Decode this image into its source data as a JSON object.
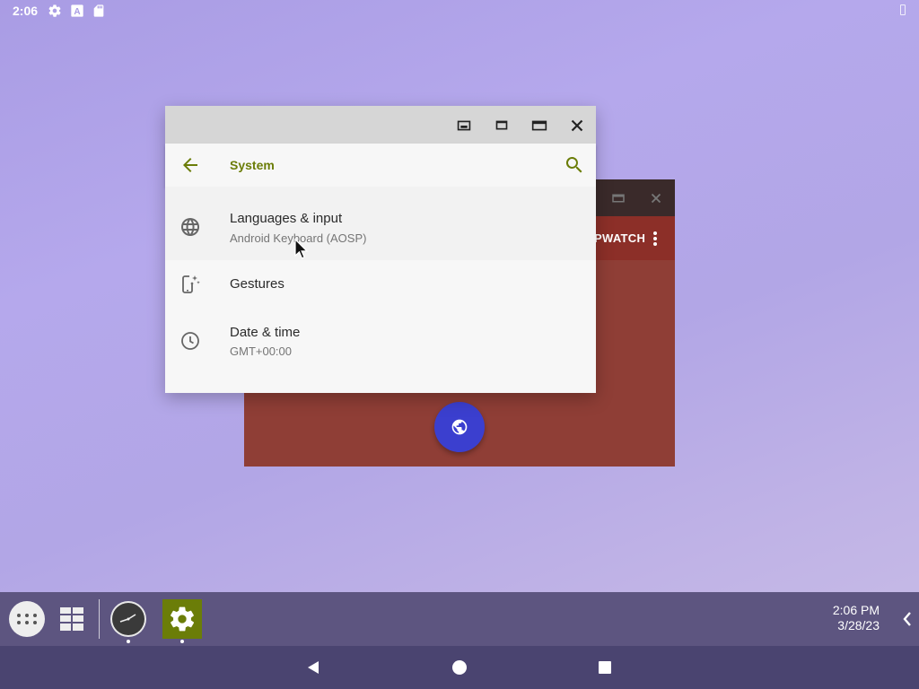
{
  "status_bar": {
    "time": "2:06",
    "icons": [
      "gear-icon",
      "keyboard-a-icon",
      "sd-card-icon",
      "battery-icon"
    ]
  },
  "background_app": {
    "tab_text": "PWATCH",
    "accent_color": "#8c2f28",
    "fab_icon": "globe-icon",
    "fab_color": "#3b3fcf"
  },
  "settings_window": {
    "title": "System",
    "accent_color": "#6b7d08",
    "caption_buttons": [
      "snap-icon",
      "restore-icon",
      "maximize-icon",
      "close-icon"
    ],
    "items": [
      {
        "icon": "globe-icon",
        "title": "Languages & input",
        "subtitle": "Android Keyboard (AOSP)"
      },
      {
        "icon": "gestures-icon",
        "title": "Gestures",
        "subtitle": ""
      },
      {
        "icon": "clock-icon",
        "title": "Date & time",
        "subtitle": "GMT+00:00"
      }
    ]
  },
  "taskbar": {
    "time": "2:06 PM",
    "date": "3/28/23",
    "apps": [
      "all-apps-icon",
      "recents-grid-icon",
      "clock-app-icon",
      "settings-app-icon"
    ]
  },
  "navbar": {
    "buttons": [
      "back-icon",
      "home-icon",
      "recents-icon"
    ]
  }
}
